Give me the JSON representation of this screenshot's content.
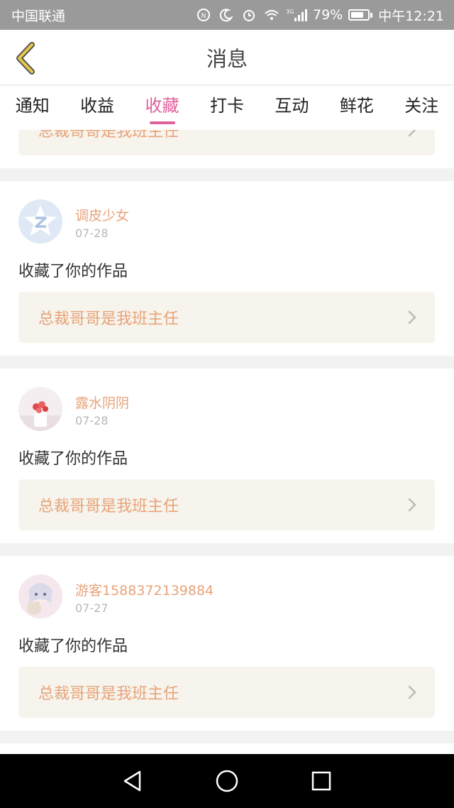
{
  "status_bar": {
    "carrier": "中国联通",
    "network": "3G",
    "battery_percent": "79%",
    "time": "中午12:21",
    "battery_level": 0.79,
    "icons": [
      "nfc-icon",
      "moon-icon",
      "alarm-icon",
      "wifi-icon",
      "signal-icon",
      "battery-icon"
    ]
  },
  "header": {
    "title": "消息",
    "back_icon": "chevron-left-icon"
  },
  "tabs": [
    {
      "label": "通知",
      "active": false
    },
    {
      "label": "收益",
      "active": false
    },
    {
      "label": "收藏",
      "active": true
    },
    {
      "label": "打卡",
      "active": false
    },
    {
      "label": "互动",
      "active": false
    },
    {
      "label": "鲜花",
      "active": false
    },
    {
      "label": "关注",
      "active": false
    }
  ],
  "items": [
    {
      "username": "",
      "date": "",
      "action": "",
      "work_title": "总裁哥哥是我班主任"
    },
    {
      "username": "调皮少女",
      "date": "07-28",
      "action": "收藏了你的作品",
      "work_title": "总裁哥哥是我班主任"
    },
    {
      "username": "露水阴阴",
      "date": "07-28",
      "action": "收藏了你的作品",
      "work_title": "总裁哥哥是我班主任"
    },
    {
      "username": "游客1588372139884",
      "date": "07-27",
      "action": "收藏了你的作品",
      "work_title": "总裁哥哥是我班主任"
    }
  ],
  "colors": {
    "accent_pink": "#e0609a",
    "username_orange": "#e8a37a",
    "back_arrow_yellow": "#e6c84a",
    "work_box_bg": "#f6f4ec"
  }
}
